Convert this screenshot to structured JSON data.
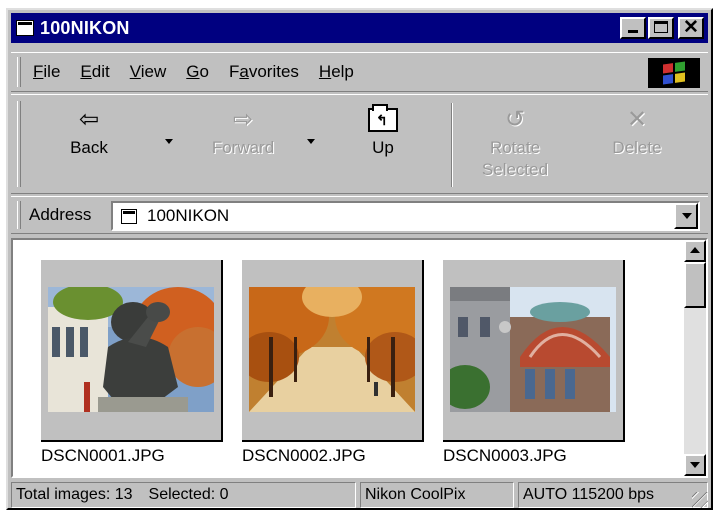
{
  "window": {
    "title": "100NIKON"
  },
  "menu": {
    "items": [
      {
        "label": "File",
        "accel": "F",
        "rest": "ile"
      },
      {
        "label": "Edit",
        "accel": "E",
        "rest": "dit"
      },
      {
        "label": "View",
        "accel": "V",
        "rest": "iew"
      },
      {
        "label": "Go",
        "accel": "G",
        "rest": "o"
      },
      {
        "label": "Favorites",
        "pre": "F",
        "accel": "a",
        "rest": "vorites"
      },
      {
        "label": "Help",
        "accel": "H",
        "rest": "elp"
      }
    ]
  },
  "toolbar": {
    "back_label": "Back",
    "forward_label": "Forward",
    "up_label": "Up",
    "rotate_label_1": "Rotate",
    "rotate_label_2": "Selected",
    "delete_label": "Delete"
  },
  "address": {
    "label": "Address",
    "value": "100NIKON"
  },
  "files": [
    {
      "name": "DSCN0001.JPG"
    },
    {
      "name": "DSCN0002.JPG"
    },
    {
      "name": "DSCN0003.JPG"
    }
  ],
  "status": {
    "images": "Total images: 13",
    "selected": "Selected: 0",
    "camera": "Nikon CoolPix",
    "connection": "AUTO  115200 bps"
  }
}
